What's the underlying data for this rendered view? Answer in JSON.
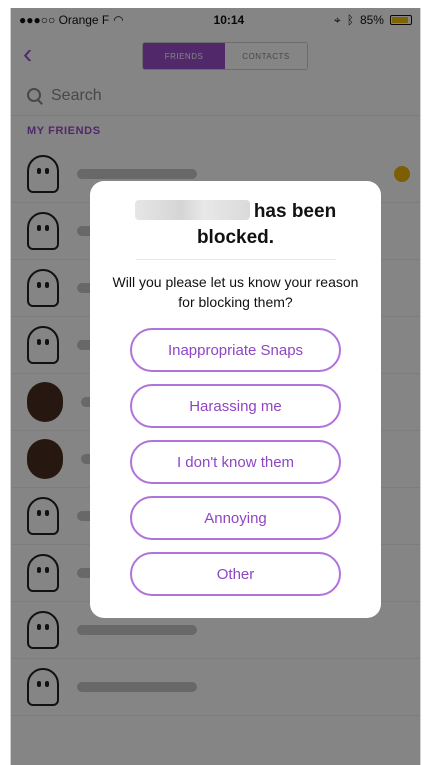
{
  "status_bar": {
    "carrier": "●●●○○ Orange F",
    "time": "10:14",
    "battery": "85%"
  },
  "nav": {
    "tabs": [
      "FRIENDS",
      "CONTACTS"
    ],
    "active_tab": "FRIENDS"
  },
  "search": {
    "placeholder": "Search"
  },
  "friends_section": {
    "title": "MY FRIENDS"
  },
  "dialog": {
    "title_suffix": "has been blocked.",
    "question": "Will you please let us know your reason for blocking them?",
    "reasons": [
      "Inappropriate Snaps",
      "Harassing me",
      "I don't know them",
      "Annoying",
      "Other"
    ]
  },
  "colors": {
    "accent": "#9b4dca",
    "overlay": "#000000"
  }
}
